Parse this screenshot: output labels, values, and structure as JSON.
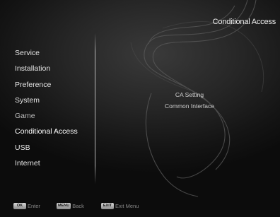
{
  "header": {
    "title": "Conditional Access"
  },
  "menu": {
    "items": [
      {
        "label": "Service"
      },
      {
        "label": "Installation"
      },
      {
        "label": "Preference"
      },
      {
        "label": "System"
      },
      {
        "label": "Game"
      },
      {
        "label": "Conditional Access"
      },
      {
        "label": "USB"
      },
      {
        "label": "Internet"
      }
    ],
    "selected": "Conditional Access"
  },
  "submenu": {
    "items": [
      {
        "label": "CA Setting"
      },
      {
        "label": "Common Interface"
      }
    ]
  },
  "footer": {
    "hints": [
      {
        "key": "OK",
        "label": "Enter"
      },
      {
        "key": "MENU",
        "label": "Back"
      },
      {
        "key": "EXIT",
        "label": "Exit Menu"
      }
    ]
  }
}
